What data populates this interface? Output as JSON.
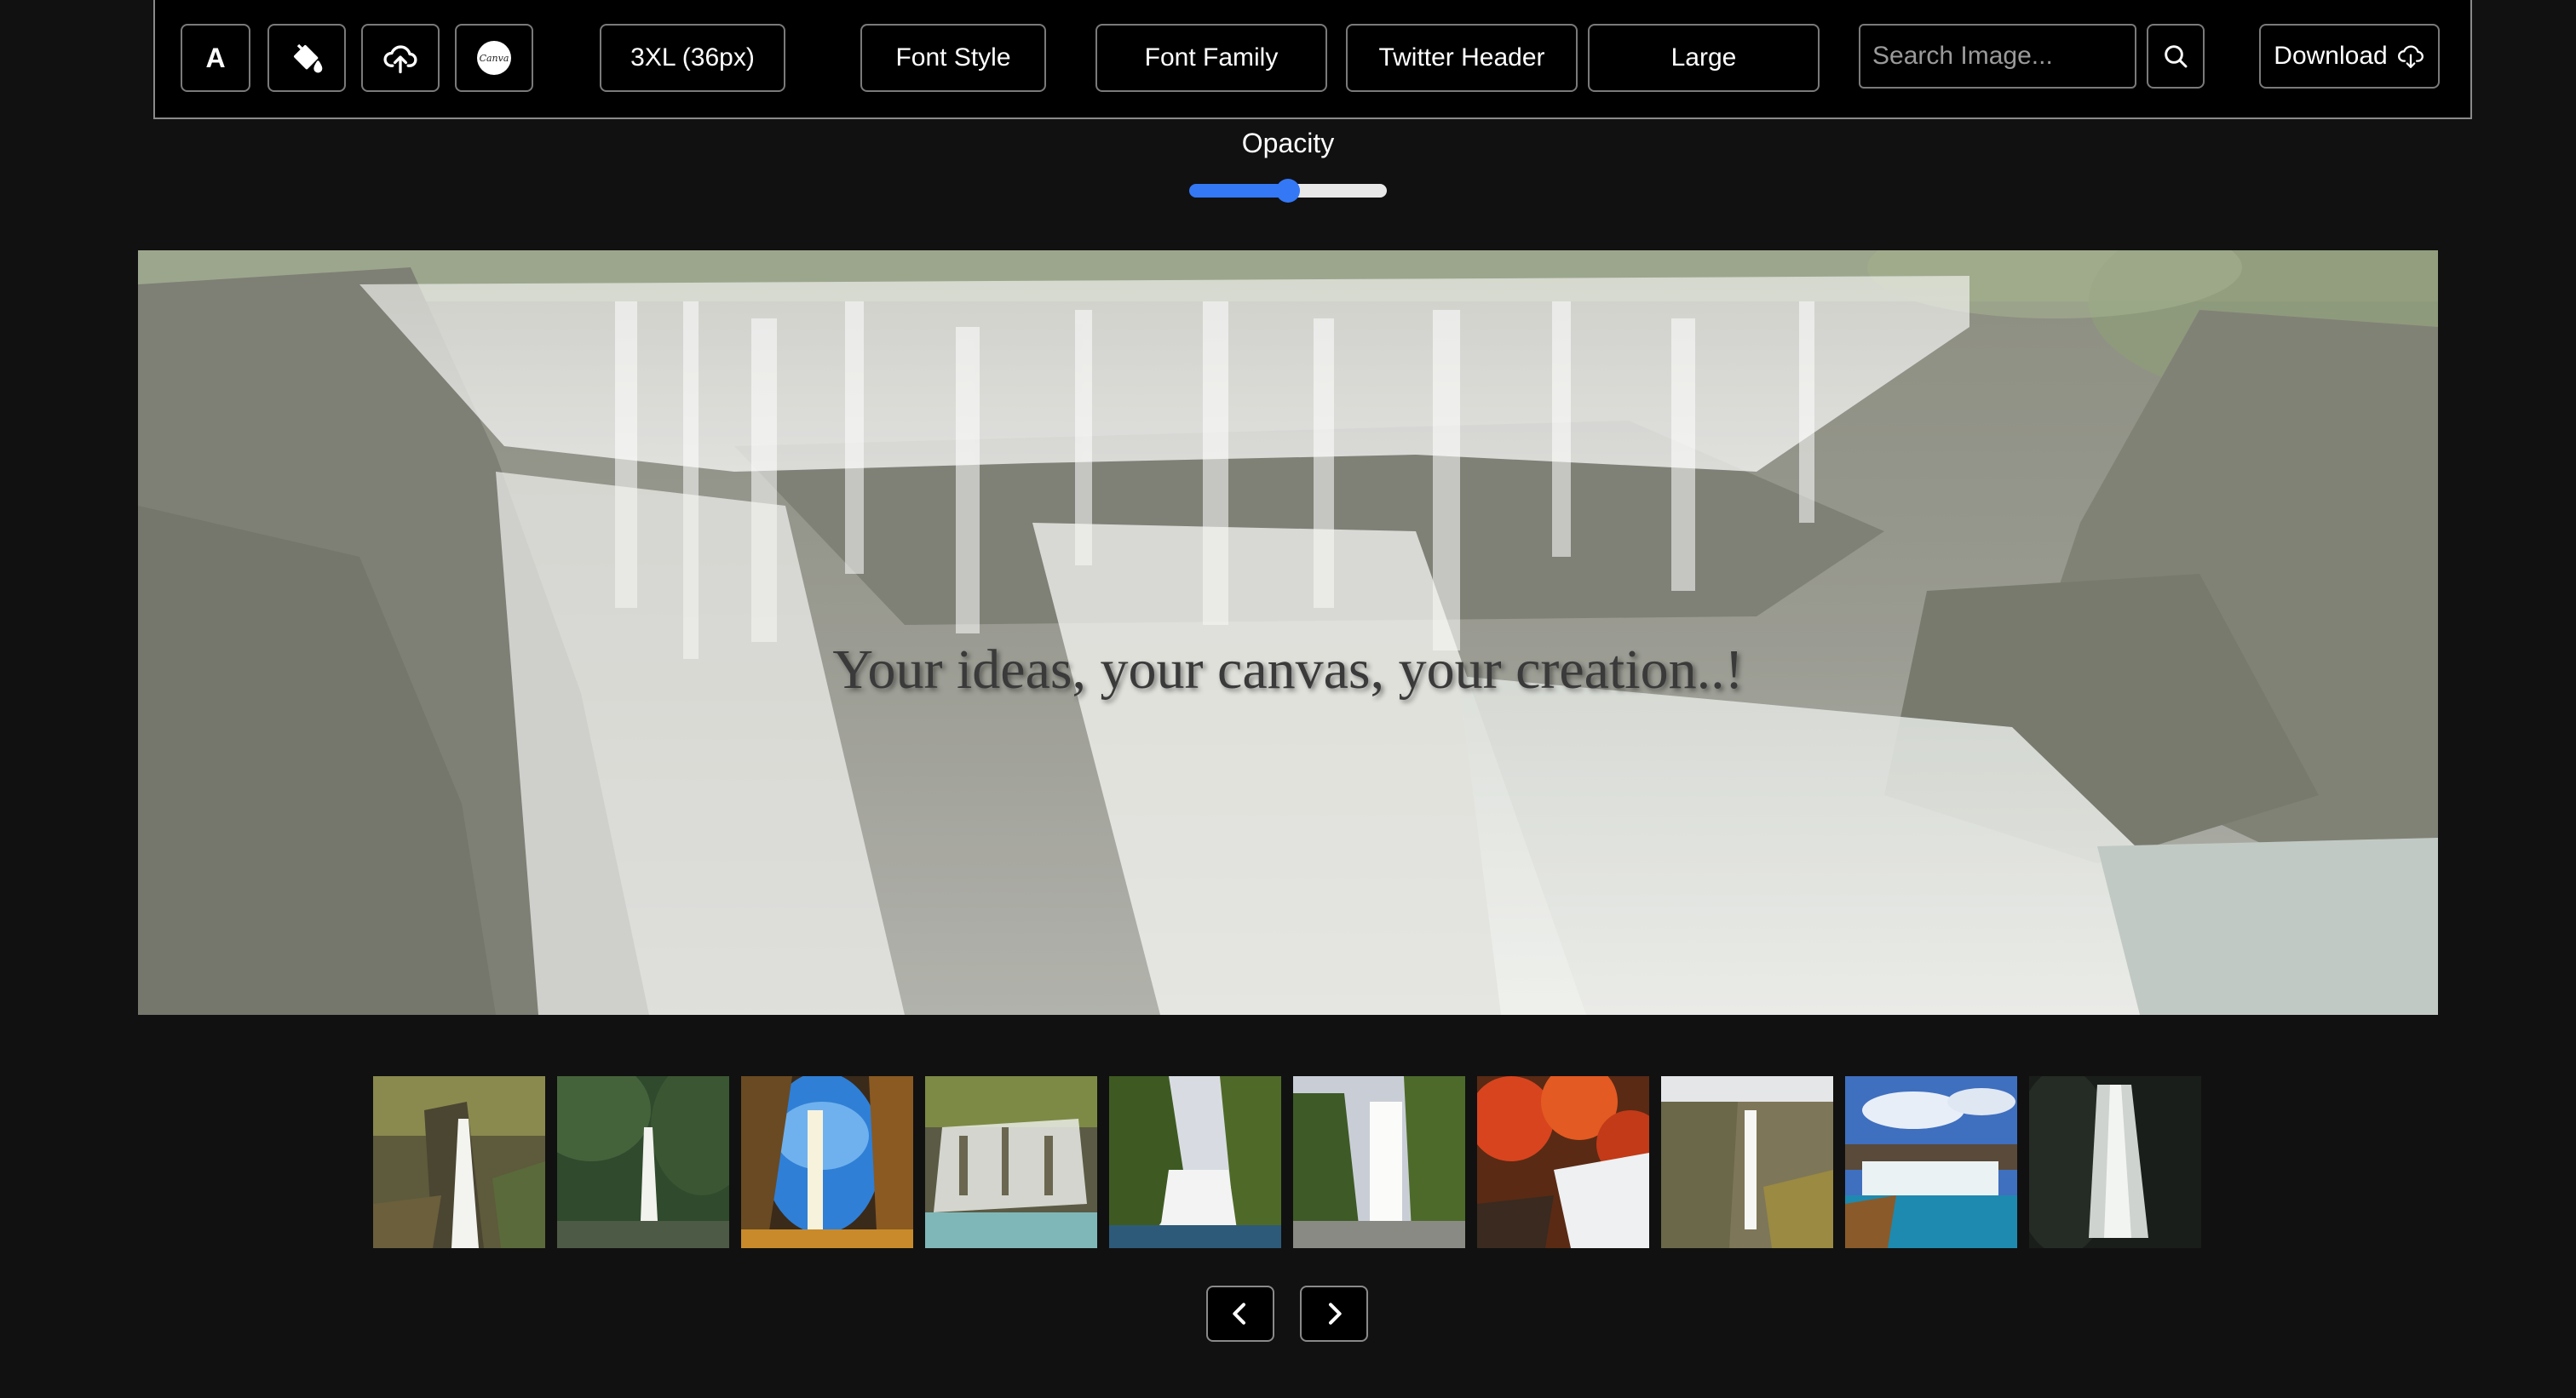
{
  "toolbar": {
    "text_icon_label": "A",
    "canva_badge_text": "Canva",
    "font_size_label": "3XL (36px)",
    "font_style_label": "Font Style",
    "font_family_label": "Font Family",
    "template_label": "Twitter Header",
    "size_label": "Large",
    "search_placeholder": "Search Image...",
    "search_value": "",
    "download_label": "Download"
  },
  "opacity": {
    "label": "Opacity",
    "value": 0.5,
    "accent_color": "#3478f6"
  },
  "canvas": {
    "text": "Your ideas, your canvas, your creation..!",
    "image_subject": "waterfall"
  },
  "thumbnails": [
    {
      "name": "waterfall-thumb-1"
    },
    {
      "name": "waterfall-thumb-2"
    },
    {
      "name": "waterfall-thumb-3"
    },
    {
      "name": "waterfall-thumb-4"
    },
    {
      "name": "waterfall-thumb-5"
    },
    {
      "name": "waterfall-thumb-6"
    },
    {
      "name": "waterfall-thumb-7"
    },
    {
      "name": "waterfall-thumb-8"
    },
    {
      "name": "waterfall-thumb-9"
    },
    {
      "name": "waterfall-thumb-10"
    }
  ],
  "pager": {
    "prev_icon": "chevron-left-icon",
    "next_icon": "chevron-right-icon"
  },
  "colors": {
    "background": "#111111",
    "toolbar_background": "#000000",
    "border": "#7a7a7a"
  }
}
